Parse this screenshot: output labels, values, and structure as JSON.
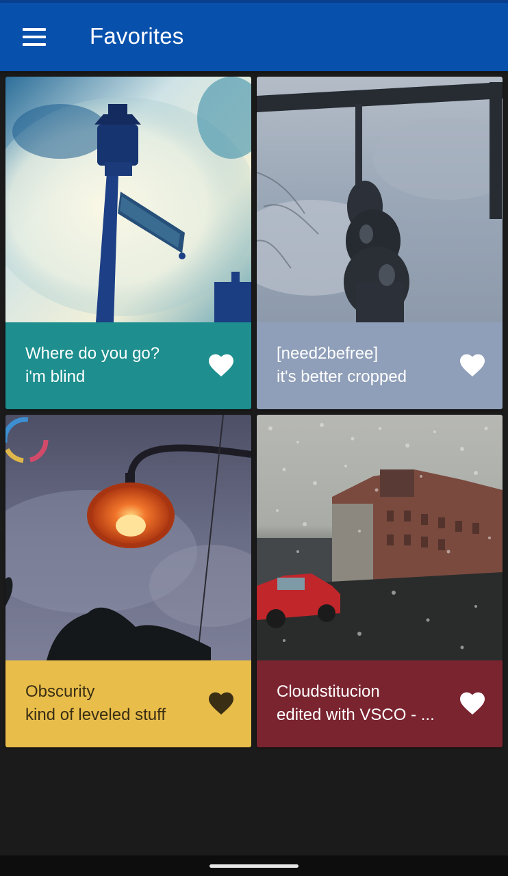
{
  "appbar": {
    "title": "Favorites",
    "menu_icon": "hamburger-menu-icon",
    "color": "#0751ad"
  },
  "cards": [
    {
      "title": "Where do you go?",
      "subtitle": "i'm blind",
      "caption_color": "#1e8e8e",
      "text_color": "#ffffff",
      "favorite": true,
      "heart_color": "#ffffff",
      "image": "street-lamp-sign-clouds"
    },
    {
      "title": "[need2befree]",
      "subtitle": "it's better cropped",
      "caption_color": "#8f9fb9",
      "text_color": "#ffffff",
      "favorite": true,
      "heart_color": "#ffffff",
      "image": "hanging-chain-sky"
    },
    {
      "title": "Obscurity",
      "subtitle": "kind of leveled stuff",
      "caption_color": "#e8bd4a",
      "text_color": "#3a2e14",
      "favorite": true,
      "heart_color": "#3a2e14",
      "image": "orange-street-lamp"
    },
    {
      "title": "Cloudstitucion",
      "subtitle": "edited with VSCO - ...",
      "caption_color": "#7a2430",
      "text_color": "#ffffff",
      "favorite": true,
      "heart_color": "#ffffff",
      "image": "rainy-window-street"
    }
  ],
  "loading_indicator": "loading-spinner-icon"
}
